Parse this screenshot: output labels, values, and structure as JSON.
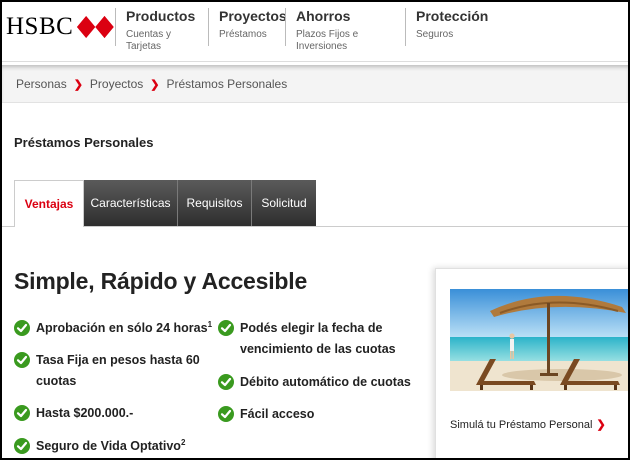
{
  "brand": {
    "logo_text": "HSBC",
    "red": "#db0011"
  },
  "nav": [
    {
      "title": "Productos",
      "sub": "Cuentas y Tarjetas"
    },
    {
      "title": "Proyectos",
      "sub": "Préstamos"
    },
    {
      "title": "Ahorros",
      "sub": "Plazos Fijos e Inversiones"
    },
    {
      "title": "Protección",
      "sub": "Seguros"
    }
  ],
  "breadcrumb": {
    "items": [
      "Personas",
      "Proyectos",
      "Préstamos Personales"
    ],
    "separator": "❯"
  },
  "page_title": "Préstamos Personales",
  "tabs": [
    {
      "label": "Ventajas",
      "active": true
    },
    {
      "label": "Características",
      "active": false
    },
    {
      "label": "Requisitos",
      "active": false
    },
    {
      "label": "Solicitud",
      "active": false
    }
  ],
  "headline": "Simple, Rápido y Accesible",
  "benefits": [
    {
      "text": "Aprobación en sólo 24 horas",
      "sup": "1"
    },
    {
      "text": "Tasa Fija en pesos hasta 60 cuotas",
      "sup": ""
    },
    {
      "text": "Hasta $200.000.-",
      "sup": ""
    },
    {
      "text": "Seguro de Vida Optativo",
      "sup": "2"
    },
    {
      "text": "Podés elegir la fecha de vencimiento de las cuotas",
      "sup": ""
    },
    {
      "text": "Débito automático de cuotas",
      "sup": ""
    },
    {
      "text": "Fácil acceso",
      "sup": ""
    }
  ],
  "promo": {
    "link_text": "Simulá tu Préstamo Personal",
    "chevron": "❯",
    "image_icon": "beach-loungers-image"
  },
  "icons": {
    "check": "check-circle-icon",
    "check_color": "#3a9a1f"
  }
}
